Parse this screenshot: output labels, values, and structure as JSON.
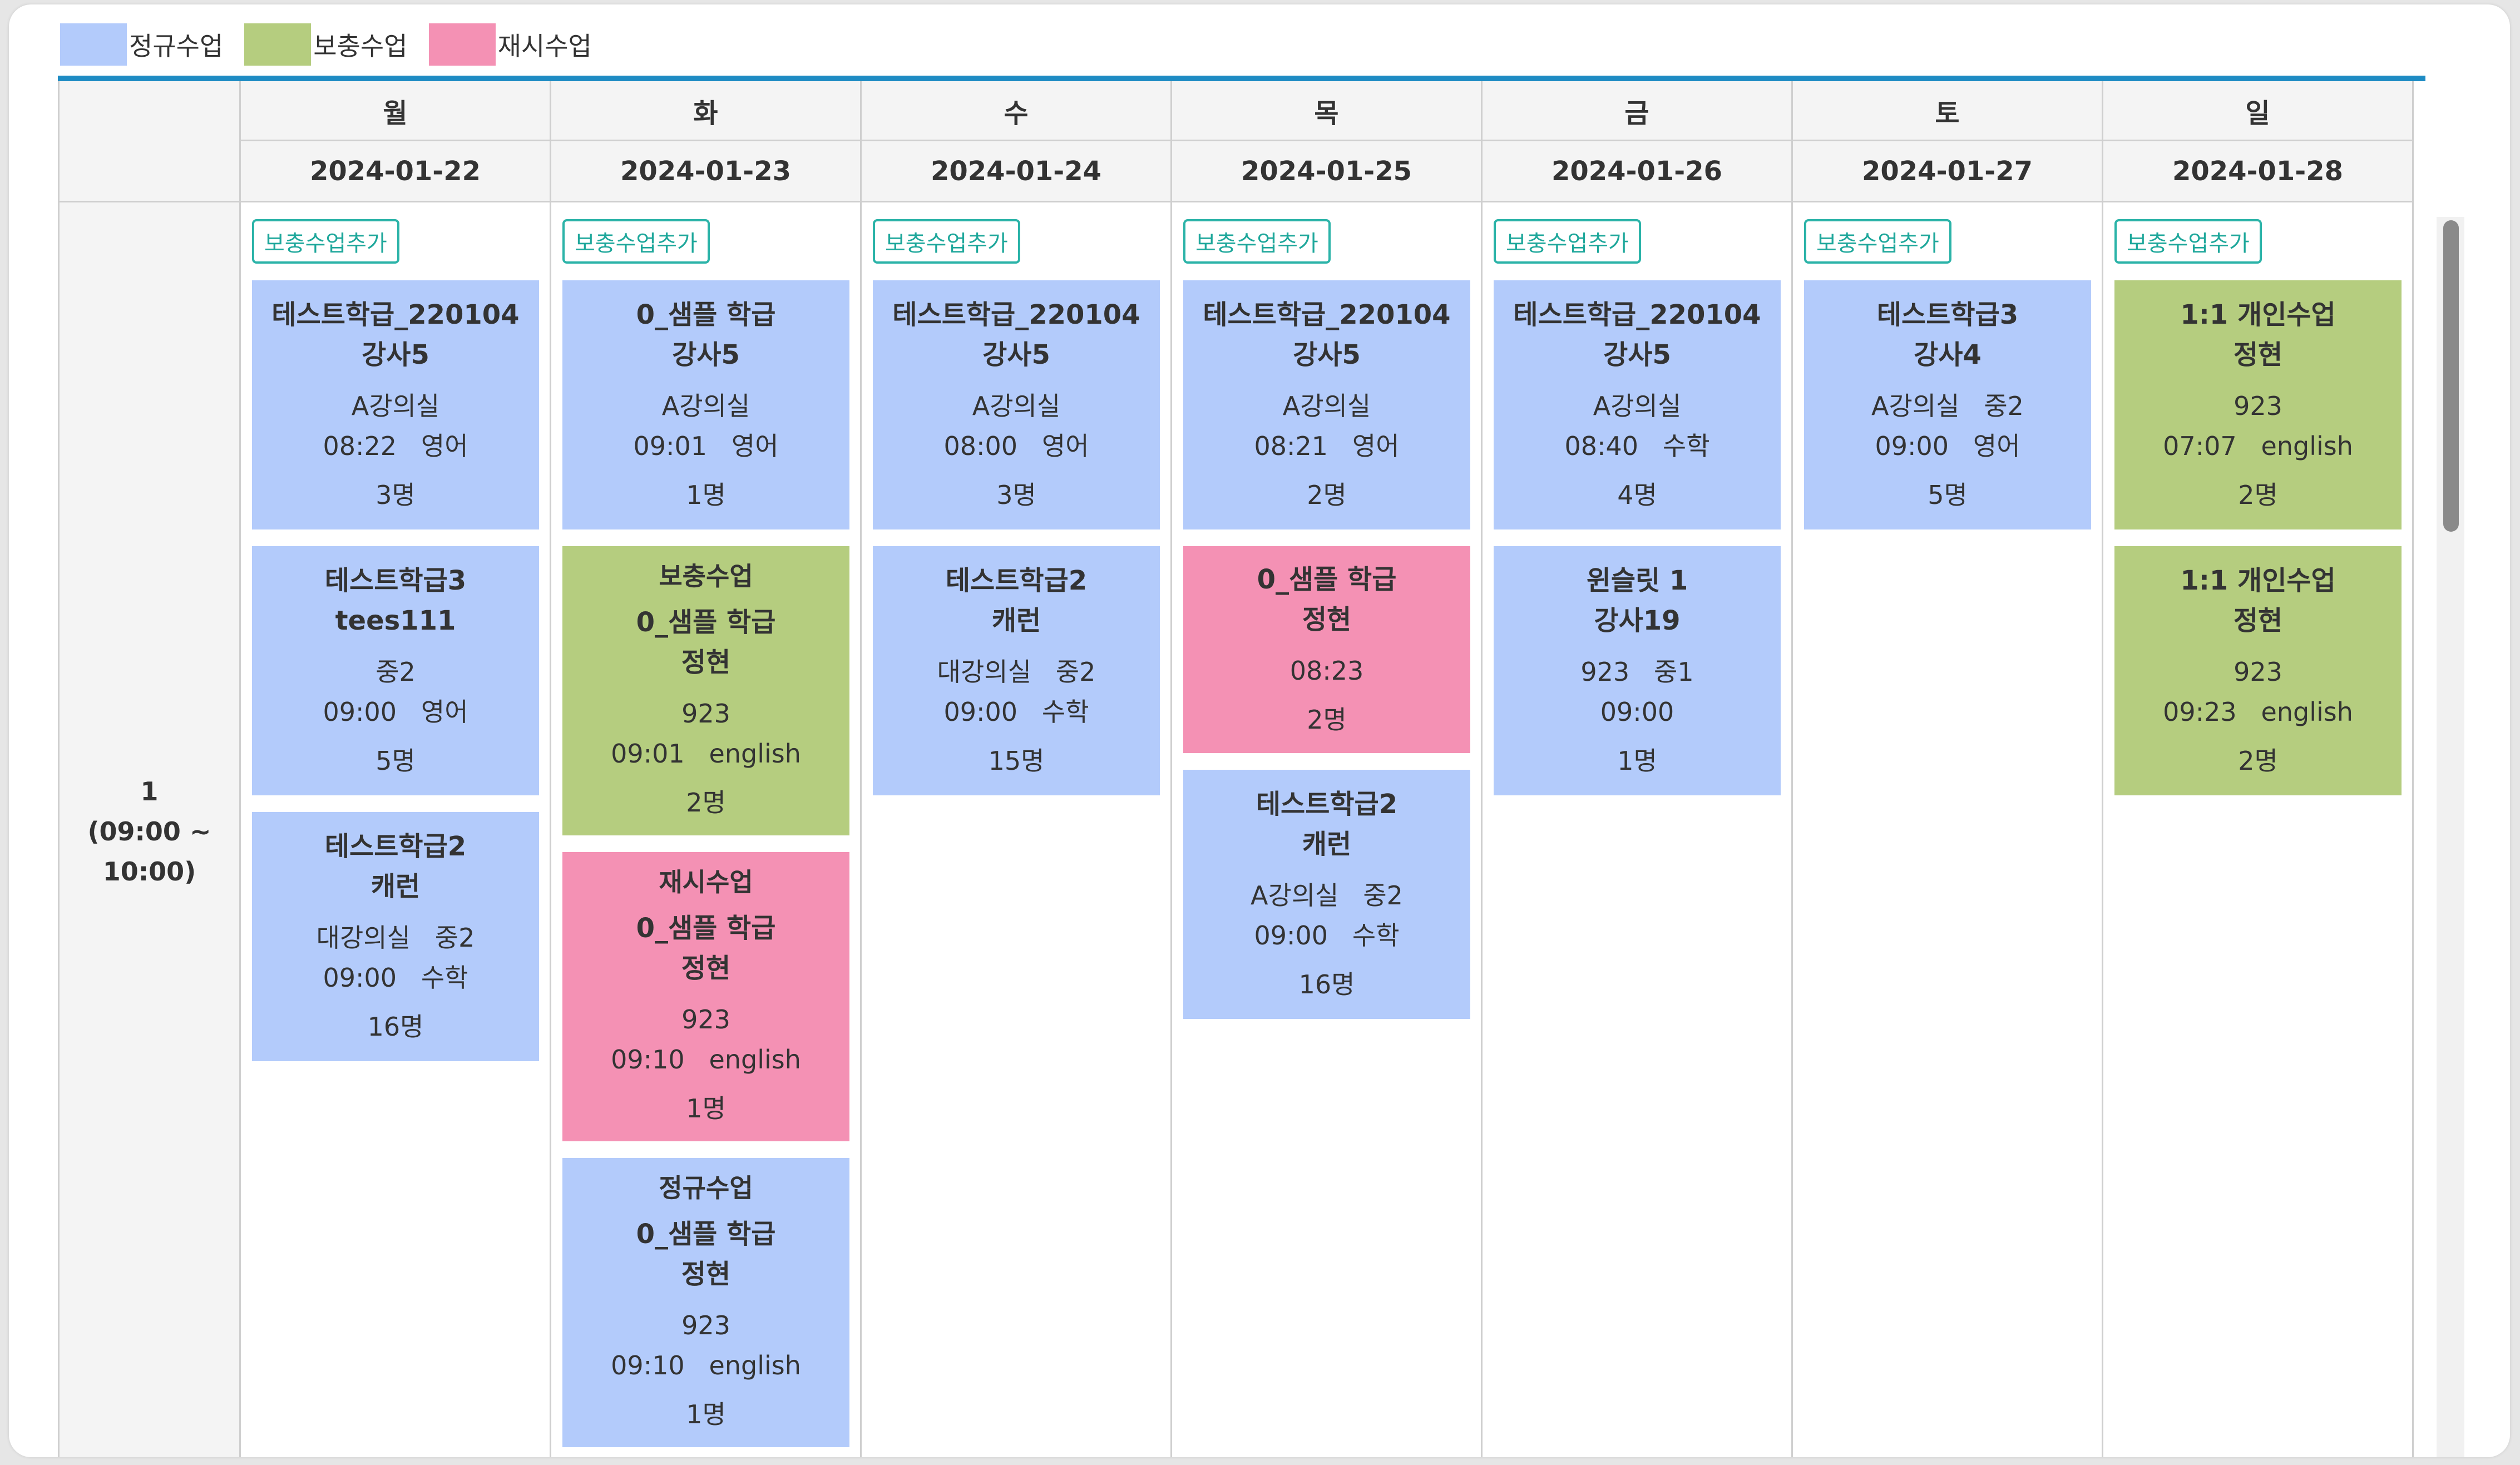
{
  "legend": [
    {
      "label": "정규수업",
      "color": "#b3cbfb"
    },
    {
      "label": "보충수업",
      "color": "#b5cd7f"
    },
    {
      "label": "재시수업",
      "color": "#f491b4"
    }
  ],
  "period": {
    "number": "1",
    "time": "(09:00 ~",
    "time_end": "10:00)"
  },
  "add_button_label": "보충수업추가",
  "days": [
    {
      "weekday": "월",
      "date": "2024-01-22",
      "cards": [
        {
          "kind": "regular",
          "title": [
            "테스트학급_220104",
            "강사5"
          ],
          "info": [
            "A강의실",
            "08:22   영어"
          ],
          "count": "3명"
        },
        {
          "kind": "regular",
          "title": [
            "테스트학급3",
            "tees111"
          ],
          "info": [
            "중2",
            "09:00   영어"
          ],
          "count": "5명"
        },
        {
          "kind": "regular",
          "title": [
            "테스트학급2",
            "캐런"
          ],
          "info": [
            "대강의실   중2",
            "09:00   수학"
          ],
          "count": "16명"
        }
      ]
    },
    {
      "weekday": "화",
      "date": "2024-01-23",
      "cards": [
        {
          "kind": "regular",
          "title": [
            "0_샘플 학급",
            "강사5"
          ],
          "info": [
            "A강의실",
            "09:01   영어"
          ],
          "count": "1명"
        },
        {
          "kind": "supp",
          "type": "보충수업",
          "title": [
            "0_샘플 학급",
            "정현"
          ],
          "info": [
            "923",
            "09:01   english"
          ],
          "count": "2명"
        },
        {
          "kind": "retake",
          "type": "재시수업",
          "title": [
            "0_샘플 학급",
            "정현"
          ],
          "info": [
            "923",
            "09:10   english"
          ],
          "count": "1명"
        },
        {
          "kind": "regular",
          "type": "정규수업",
          "title": [
            "0_샘플 학급",
            "정현"
          ],
          "info": [
            "923",
            "09:10   english"
          ],
          "count": "1명"
        }
      ]
    },
    {
      "weekday": "수",
      "date": "2024-01-24",
      "cards": [
        {
          "kind": "regular",
          "title": [
            "테스트학급_220104",
            "강사5"
          ],
          "info": [
            "A강의실",
            "08:00   영어"
          ],
          "count": "3명"
        },
        {
          "kind": "regular",
          "title": [
            "테스트학급2",
            "캐런"
          ],
          "info": [
            "대강의실   중2",
            "09:00   수학"
          ],
          "count": "15명"
        }
      ]
    },
    {
      "weekday": "목",
      "date": "2024-01-25",
      "cards": [
        {
          "kind": "regular",
          "title": [
            "테스트학급_220104",
            "강사5"
          ],
          "info": [
            "A강의실",
            "08:21   영어"
          ],
          "count": "2명"
        },
        {
          "kind": "retake",
          "title": [
            "0_샘플 학급",
            "정현"
          ],
          "info": [
            "08:23"
          ],
          "count": "2명"
        },
        {
          "kind": "regular",
          "title": [
            "테스트학급2",
            "캐런"
          ],
          "info": [
            "A강의실   중2",
            "09:00   수학"
          ],
          "count": "16명"
        }
      ]
    },
    {
      "weekday": "금",
      "date": "2024-01-26",
      "cards": [
        {
          "kind": "regular",
          "title": [
            "테스트학급_220104",
            "강사5"
          ],
          "info": [
            "A강의실",
            "08:40   수학"
          ],
          "count": "4명"
        },
        {
          "kind": "regular",
          "title": [
            "윈슬릿 1",
            "강사19"
          ],
          "info": [
            "923   중1",
            "09:00"
          ],
          "count": "1명"
        }
      ]
    },
    {
      "weekday": "토",
      "date": "2024-01-27",
      "cards": [
        {
          "kind": "regular",
          "title": [
            "테스트학급3",
            "강사4"
          ],
          "info": [
            "A강의실   중2",
            "09:00   영어"
          ],
          "count": "5명"
        }
      ]
    },
    {
      "weekday": "일",
      "date": "2024-01-28",
      "cards": [
        {
          "kind": "supp",
          "title": [
            "1:1 개인수업",
            "정현"
          ],
          "info": [
            "923",
            "07:07   english"
          ],
          "count": "2명"
        },
        {
          "kind": "supp",
          "title": [
            "1:1 개인수업",
            "정현"
          ],
          "info": [
            "923",
            "09:23   english"
          ],
          "count": "2명"
        }
      ]
    }
  ]
}
